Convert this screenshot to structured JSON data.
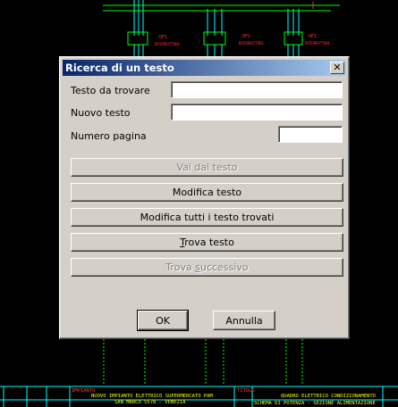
{
  "cad": {
    "top_tags": [
      "-QF1",
      "-QF1",
      "-QF1"
    ],
    "top_subtags": [
      "INTERRUTTORE",
      "INTERRUTTORE",
      "INTERRUTTORE"
    ],
    "title_block": {
      "left_label": "IMPIANTO",
      "project_line1": "NUOVO IMPIANTO ELETTRICO SUPERMERCATO PAM",
      "project_line2": "SAN MARCO 5578 - VENEZIA",
      "right_label": "TITOLO",
      "title_line1": "QUADRO ELETTRICO CONDIZIONAMENTO",
      "title_line2": "SCHEMA DI POTENZA - SEZIONE ALIMENTAZIONE"
    }
  },
  "dialog": {
    "title": "Ricerca di un testo",
    "close_glyph": "✕",
    "find_label": "Testo da trovare",
    "find_value": "",
    "new_label": "Nuovo testo",
    "new_value": "",
    "page_label": "Numero pagina",
    "page_value": "",
    "buttons": {
      "goto": "Vai dal testo",
      "modify": "Modifica testo",
      "modify_all": "Modifica tutti i testo trovati",
      "find_prefix": "T",
      "find_rest": "rova testo",
      "find_next_prefix": "Trova ",
      "find_next_underlined": "s",
      "find_next_rest": "uccessivo",
      "ok": "OK",
      "cancel": "Annulla"
    }
  }
}
